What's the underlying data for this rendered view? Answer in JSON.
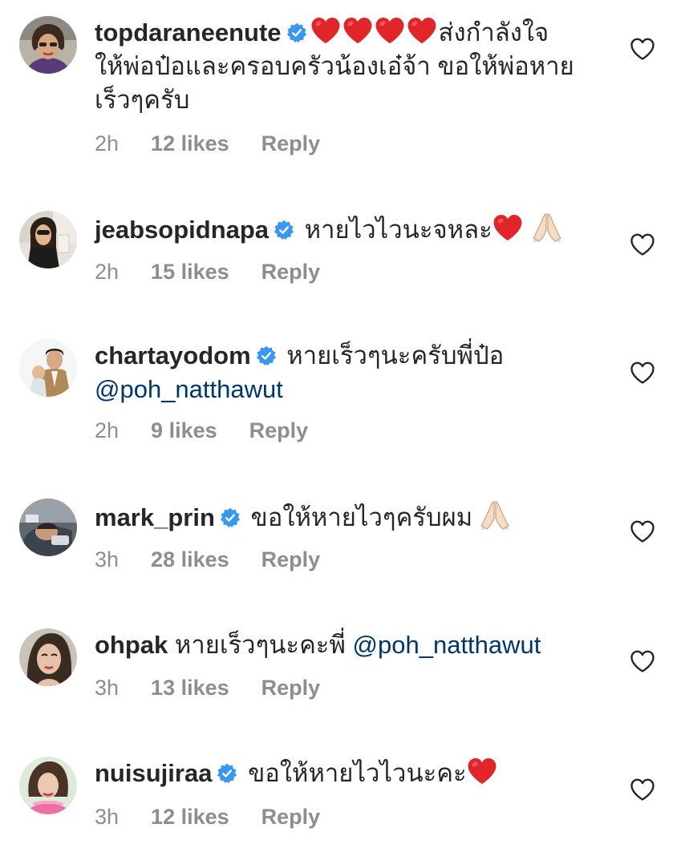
{
  "comments": [
    {
      "username": "topdaraneenute",
      "verified": true,
      "text_line1": "ส่งกำลังใจ",
      "text_line2": "ให้พ่อป๋อและครอบครัวน้องเอ๋จ้า ขอให้พ่อหาย",
      "text_line3": "เร็วๆครับ",
      "time": "2h",
      "likes": "12 likes",
      "reply": "Reply"
    },
    {
      "username": "jeabsopidnapa",
      "verified": true,
      "text": "หายไวไวนะจหละ",
      "time": "2h",
      "likes": "15 likes",
      "reply": "Reply"
    },
    {
      "username": "chartayodom",
      "verified": true,
      "text": "หายเร็วๆนะครับพี่ป๋อ",
      "mention": "@poh_natthawut",
      "time": "2h",
      "likes": "9 likes",
      "reply": "Reply"
    },
    {
      "username": "mark_prin",
      "verified": true,
      "text": "ขอให้หายไวๆครับผม",
      "time": "3h",
      "likes": "28 likes",
      "reply": "Reply"
    },
    {
      "username": "ohpak",
      "verified": false,
      "text": "หายเร็วๆนะคะพี่",
      "mention": "@poh_natthawut",
      "time": "3h",
      "likes": "13 likes",
      "reply": "Reply"
    },
    {
      "username": "nuisujiraa",
      "verified": true,
      "text": "ขอให้หายไวไวนะคะ",
      "time": "3h",
      "likes": "12 likes",
      "reply": "Reply"
    }
  ],
  "colors": {
    "username": "#262626",
    "text": "#262626",
    "meta": "#8e8e8e",
    "mention": "#00376b",
    "verified_badge": "#3897f0",
    "heart": "#e0262b"
  },
  "icons": {
    "like": "heart-outline-icon",
    "verified": "verified-badge-icon",
    "heart_emoji": "red-heart-emoji",
    "pray_emoji": "folded-hands-emoji"
  }
}
